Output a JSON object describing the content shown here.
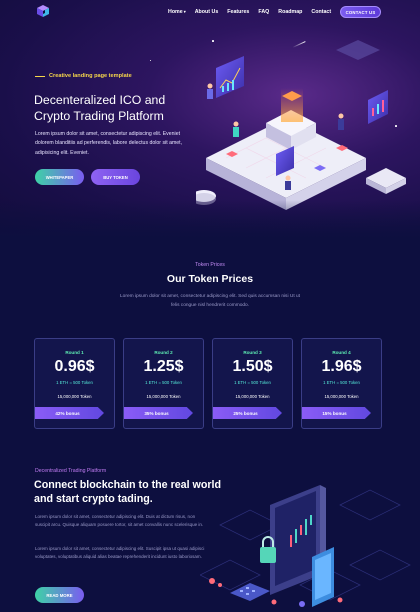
{
  "nav": {
    "links": [
      "Home",
      "About Us",
      "Features",
      "FAQ",
      "Roadmap",
      "Contact"
    ],
    "home_caret": "▾",
    "contact_button": "CONTACT US"
  },
  "hero": {
    "tagline": "Creative landing page template",
    "title": "Decenteralized ICO and Crypto Trading Platform",
    "description": "Lorem ipsum dolor sit amet, consectetur adipiscing elit. Eveniet dolorem blanditiis ad perferendis, labore delectus dolor sit amet, adipisicing elit. Eveniet.",
    "whitepaper_button": "WHITEPAPER",
    "buy_button": "BUY TOKEN"
  },
  "tokens": {
    "subtitle": "Token Prices",
    "title": "Our Token Prices",
    "description": "Lorem ipsum dolor sit amet, consectetur adipiscing elit. Sed quis accumsan nisi Ut ut felis congue nisl hendrerit commodo.",
    "cards": [
      {
        "round": "Round 1",
        "price": "0.96$",
        "rate": "1 ETH = 500 Token",
        "tokens": "15,000,000 Token",
        "bonus": "42% bonus"
      },
      {
        "round": "Round 2",
        "price": "1.25$",
        "rate": "1 ETH = 500 Token",
        "tokens": "15,000,000 Token",
        "bonus": "35% bonus"
      },
      {
        "round": "Round 3",
        "price": "1.50$",
        "rate": "1 ETH = 500 Token",
        "tokens": "15,000,000 Token",
        "bonus": "25% bonus"
      },
      {
        "round": "Round 4",
        "price": "1.96$",
        "rate": "1 ETH = 500 Token",
        "tokens": "15,000,000 Token",
        "bonus": "15% bonus"
      }
    ]
  },
  "trading": {
    "subtitle": "Decentralized Trading Platform",
    "title": "Connect blockchain to the real world and start crypto tading.",
    "paragraph1": "Lorem ipsum dolor sit amet, consectetur adipiscing elit. Duis at dictum risus, non suscipit arcu. Quisque aliquam posuere tortor, sit amet convallis nunc scelerisque in.",
    "paragraph2": "Lorem ipsum dolor sit amet, consectetur adipiscing elit. Suscipit ipsa ut quasi adipisci voluptates, voluptatibus aliquid alias beatae reprehenderit incidunt iusto laboriosam.",
    "read_more_button": "READ MORE"
  },
  "colors": {
    "background": "#0d0f3f",
    "accent_yellow": "#f6d64a",
    "accent_green": "#5ef0b4",
    "accent_purple": "#7b5cf0",
    "card_border": "#3a3d86"
  },
  "icons": [
    "cube-logo-icon"
  ]
}
